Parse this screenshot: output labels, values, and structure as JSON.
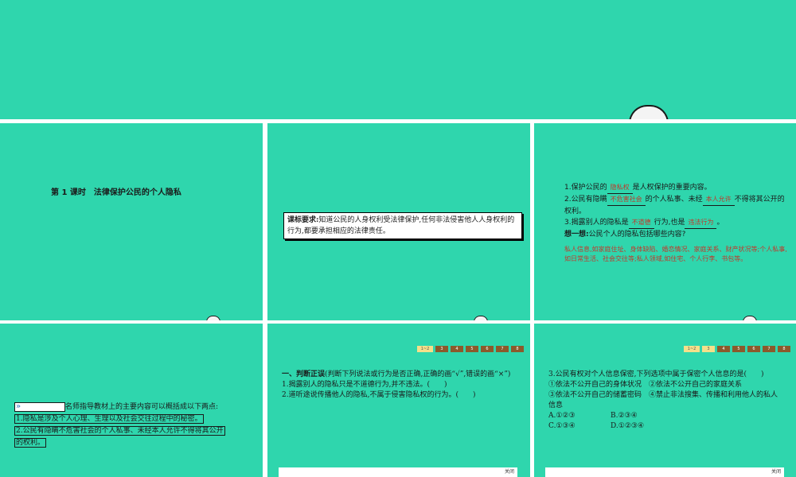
{
  "slide1": {
    "title": "第 1 课时　法律保护公民的个人隐私"
  },
  "slide2": {
    "req_label": "课标要求:",
    "req_text": "知道公民的人身权利受法律保护,任何非法侵害他人人身权利的行为,都要承担相应的法律责任。"
  },
  "slide3": {
    "l1_pre": "1.保护公民的",
    "l1_ans": "隐私权",
    "l1_post": "是人权保护的重要内容。",
    "l2_pre": "2.公民有隐瞒",
    "l2_ans1": "不危害社会",
    "l2_mid": "的个人私事、未经",
    "l2_ans2": "本人允许",
    "l2_post": "不得将其公开的权利。",
    "l3_pre": "3.揭露别人的隐私是",
    "l3_ans1": "不道德",
    "l3_mid": "行为,也是",
    "l3_ans2": "违法行为",
    "l3_post": "。",
    "think_label": "想一想:",
    "think_text": "公民个人的隐私包括哪些内容?",
    "answer": "私人信息,如家庭住址、身体缺陷、婚恋情况、家庭关系、财产状况等;个人私事,如日常生活、社会交往等;私人领域,如住宅、个人行李、书包等。"
  },
  "slide4": {
    "intro": "名师指导教材上的主要内容可以概括成以下两点:",
    "p1": "1.隐私是涉及个人心理、生理以及社会交往过程中的秘密。",
    "p2_a": "2.公民有隐瞒不危害社会的个人私事、未经本人允许不得将其公开",
    "p2_b": "的权利。"
  },
  "pager": [
    "1~2",
    "3",
    "4",
    "5",
    "6",
    "7",
    "8"
  ],
  "slide5": {
    "heading": "一、判断正误",
    "heading_note": "(判断下列说法或行为是否正确,正确的画“√”,错误的画“×”)",
    "q1": "1.揭露别人的隐私只是不道德行为,并不违法。(　　)",
    "q2": "2.道听途说传播他人的隐私,不属于侵害隐私权的行为。(　　)",
    "footer": "关闭"
  },
  "slide6": {
    "q3": "3.公民有权对个人信息保密,下列选项中属于保密个人信息的是(　　)",
    "o1": "①依法不公开自己的身体状况　②依法不公开自己的家庭关系",
    "o2": "③依法不公开自己的储蓄密码　④禁止非法搜集、传播和利用他人的私人信息",
    "a": "A.①②③",
    "b": "B.②③④",
    "c": "C.①③④",
    "d": "D.①②③④",
    "footer": "关闭"
  }
}
